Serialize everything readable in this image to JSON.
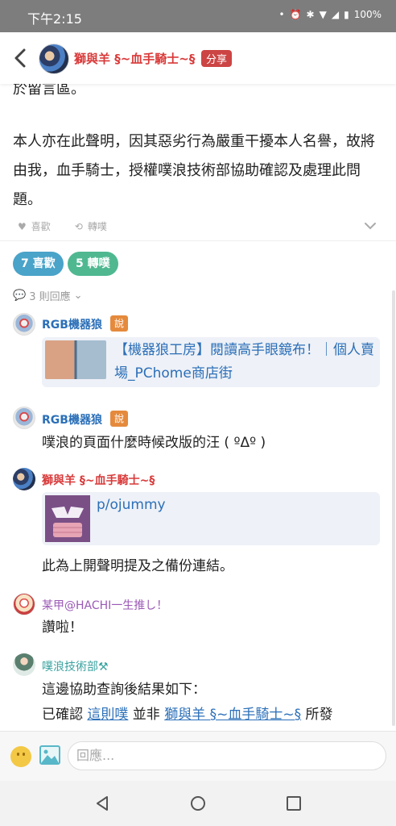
{
  "status": {
    "time": "下午2:15",
    "battery": "100%"
  },
  "header": {
    "author": "獅與羊 §~血手騎士~§",
    "share": "分享"
  },
  "post": {
    "cut_text": "於留言區。",
    "paragraph": "本人亦在此聲明，因其惡劣行為嚴重干擾本人名譽，故將由我，血手騎士，授權噗浪技術部協助確認及處理此問題。",
    "like_label": "喜歡",
    "replurk_label": "轉噗"
  },
  "stats": {
    "likes": "7 喜歡",
    "replurks": "5 轉噗"
  },
  "responses_label": "3 則回應",
  "responses": [
    {
      "name": "RGB機器狼",
      "qualifier": "說",
      "link_text": "【機器狼工房】閱讀高手眼鏡布！｜個人賣場_PChome商店街"
    },
    {
      "name": "RGB機器狼",
      "qualifier": "說",
      "text": "噗浪的頁面什麼時候改版的汪 ( ºΔº )"
    },
    {
      "name": "獅與羊 §~血手騎士~§",
      "link_text": "p/ojummy",
      "text": "此為上開聲明提及之備份連結。"
    },
    {
      "name": "某甲@HACHI一生推し！",
      "text": "讚啦！"
    },
    {
      "name": "噗浪技術部",
      "line1": "這邊協助查詢後結果如下：",
      "line2_prefix": "已確認 ",
      "line2_link1": "這則噗",
      "line2_mid": " 並非 ",
      "line2_link2": "獅與羊 §~血手騎士~§",
      "line2_suffix": " 所發"
    }
  ],
  "reply": {
    "placeholder": "回應..."
  },
  "colors": {
    "author_red": "#d93a3a",
    "link_blue": "#2b6fb8",
    "likes_pill": "#4aa3c9",
    "replurk_pill": "#4fb891",
    "qualifier": "#e58a3c"
  }
}
